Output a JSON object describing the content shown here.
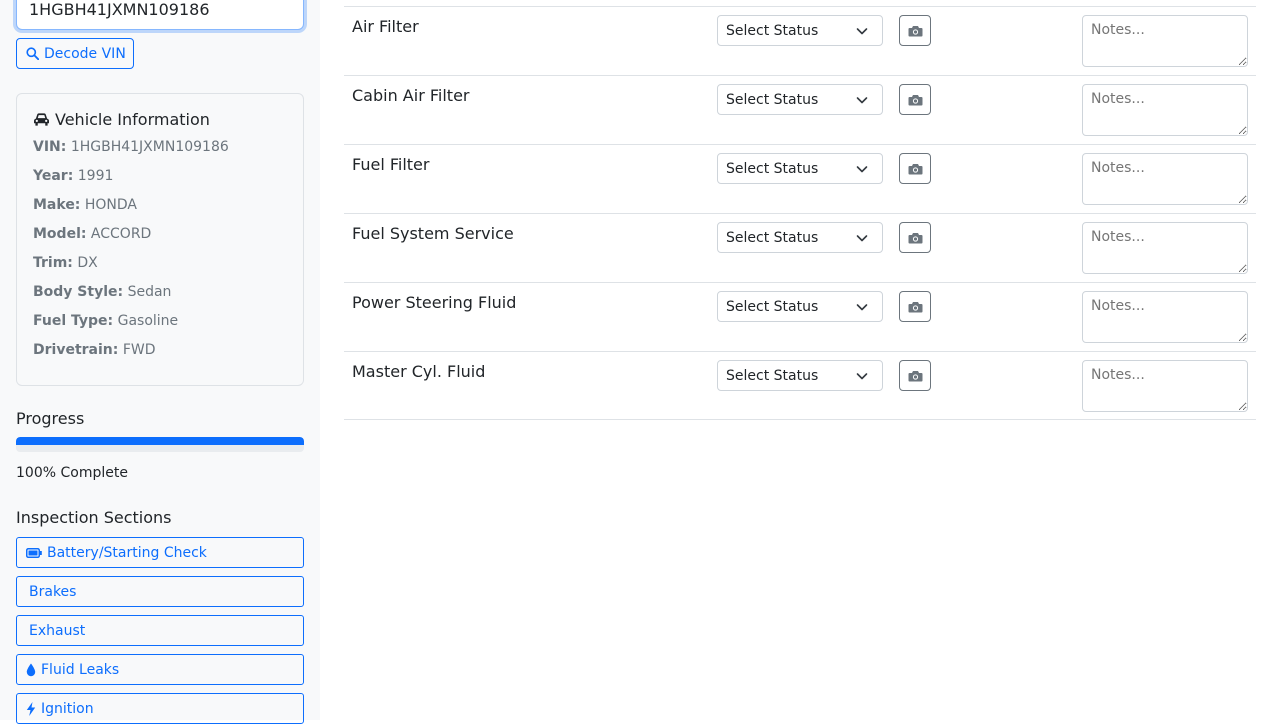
{
  "vin_input": {
    "value": "1HGBH41JXMN109186"
  },
  "decode_button": {
    "label": "Decode VIN",
    "icon": "search-icon"
  },
  "vehicle_info": {
    "title": "Vehicle Information",
    "icon": "car-icon",
    "fields": [
      {
        "label": "VIN:",
        "value": "1HGBH41JXMN109186"
      },
      {
        "label": "Year:",
        "value": "1991"
      },
      {
        "label": "Make:",
        "value": "HONDA"
      },
      {
        "label": "Model:",
        "value": "ACCORD"
      },
      {
        "label": "Trim:",
        "value": "DX"
      },
      {
        "label": "Body Style:",
        "value": "Sedan"
      },
      {
        "label": "Fuel Type:",
        "value": "Gasoline"
      },
      {
        "label": "Drivetrain:",
        "value": "FWD"
      }
    ]
  },
  "progress": {
    "label": "Progress",
    "percent": 100,
    "text": "100% Complete",
    "color": "#0d6efd"
  },
  "sections": {
    "label": "Inspection Sections",
    "items": [
      {
        "label": "Battery/Starting Check",
        "icon": "battery-icon"
      },
      {
        "label": "Brakes",
        "icon": ""
      },
      {
        "label": "Exhaust",
        "icon": ""
      },
      {
        "label": "Fluid Leaks",
        "icon": "droplet-icon"
      },
      {
        "label": "Ignition",
        "icon": "bolt-icon"
      }
    ]
  },
  "inspection_items": [
    {
      "name": "Air Filter",
      "status": "Select Status",
      "notes_placeholder": "Notes..."
    },
    {
      "name": "Cabin Air Filter",
      "status": "Select Status",
      "notes_placeholder": "Notes..."
    },
    {
      "name": "Fuel Filter",
      "status": "Select Status",
      "notes_placeholder": "Notes..."
    },
    {
      "name": "Fuel System Service",
      "status": "Select Status",
      "notes_placeholder": "Notes..."
    },
    {
      "name": "Power Steering Fluid",
      "status": "Select Status",
      "notes_placeholder": "Notes..."
    },
    {
      "name": "Master Cyl. Fluid",
      "status": "Select Status",
      "notes_placeholder": "Notes..."
    }
  ],
  "colors": {
    "primary": "#0d6efd",
    "muted": "#6c757d",
    "sidebar_bg": "#f8f9fa"
  }
}
